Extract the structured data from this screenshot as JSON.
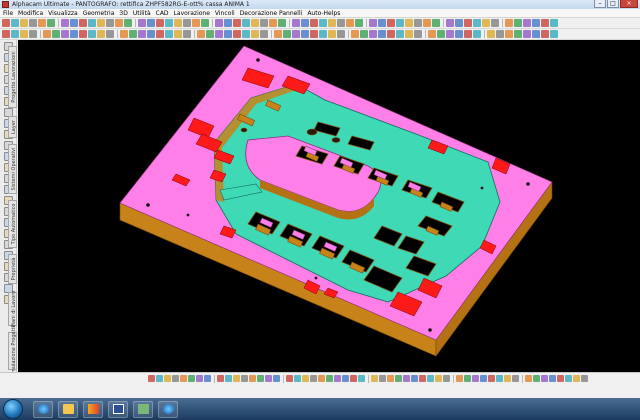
{
  "window": {
    "title": "Alphacam Ultimate - PANTOGRAFO: rettifica ZHPF582RG-E-ott% cassa ANIMA 1"
  },
  "menu": {
    "items": [
      "File",
      "Modifica",
      "Visualizza",
      "Geometria",
      "3D",
      "Utilità",
      "CAD",
      "Lavorazione",
      "Vincoli",
      "Decorazione Pannelli",
      "Auto-Helps"
    ]
  },
  "side_tabs": [
    {
      "label": "Progetto Lavorazioni"
    },
    {
      "label": "Layer"
    },
    {
      "label": "Sistemi Operativi"
    },
    {
      "label": "Tipo Automatico"
    },
    {
      "label": "Proprietà"
    },
    {
      "label": "Piani di Lavoro"
    },
    {
      "label": "Simulazione Progetto"
    }
  ],
  "icons": {
    "app": "alphacam-icon",
    "start": "windows-start-icon",
    "taskbar": [
      "ie-icon",
      "folder-icon",
      "media-icon",
      "alphacam-task-icon",
      "cad-task-icon",
      "ie-icon"
    ]
  },
  "colors": {
    "viewport_bg": "#000000",
    "top_face": "#ff7fe8",
    "side_face": "#c8821a",
    "pocket_floor": "#3fd9b5",
    "highlight": "#ff1a1a"
  }
}
